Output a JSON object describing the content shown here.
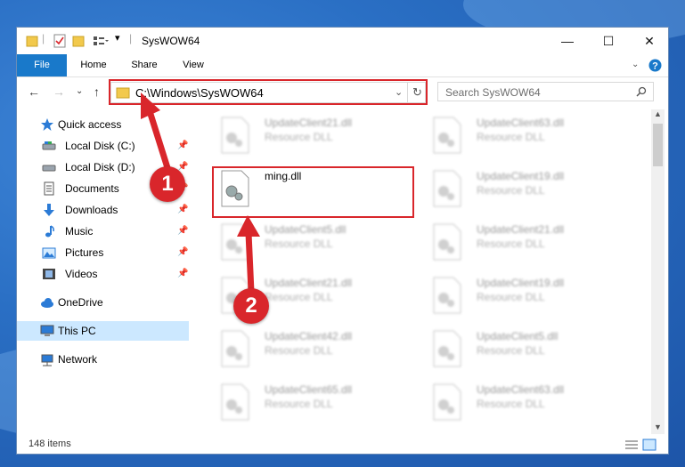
{
  "window": {
    "title": "SysWOW64"
  },
  "ribbon": {
    "tabs": [
      "File",
      "Home",
      "Share",
      "View"
    ]
  },
  "address": {
    "path": "C:\\Windows\\SysWOW64"
  },
  "search": {
    "placeholder": "Search SysWOW64"
  },
  "nav": {
    "items": [
      {
        "label": "Quick access",
        "pinned": false
      },
      {
        "label": "Local Disk (C:)",
        "pinned": true
      },
      {
        "label": "Local Disk (D:)",
        "pinned": true
      },
      {
        "label": "Documents",
        "pinned": true
      },
      {
        "label": "Downloads",
        "pinned": true
      },
      {
        "label": "Music",
        "pinned": true
      },
      {
        "label": "Pictures",
        "pinned": true
      },
      {
        "label": "Videos",
        "pinned": true
      },
      {
        "label": "OneDrive",
        "pinned": false
      },
      {
        "label": "This PC",
        "pinned": false,
        "selected": true
      },
      {
        "label": "Network",
        "pinned": false
      }
    ]
  },
  "files": {
    "left": [
      {
        "name": "UpdateClient21.dll",
        "type": "Resource DLL"
      },
      {
        "name": "ming.dll",
        "type": ""
      },
      {
        "name": "UpdateClient5.dll",
        "type": "Resource DLL"
      },
      {
        "name": "UpdateClient21.dll",
        "type": "Resource DLL"
      },
      {
        "name": "UpdateClient42.dll",
        "type": "Resource DLL"
      },
      {
        "name": "UpdateClient65.dll",
        "type": "Resource DLL"
      }
    ],
    "right": [
      {
        "name": "UpdateClient63.dll",
        "type": "Resource DLL"
      },
      {
        "name": "UpdateClient19.dll",
        "type": "Resource DLL"
      },
      {
        "name": "UpdateClient21.dll",
        "type": "Resource DLL"
      },
      {
        "name": "UpdateClient19.dll",
        "type": "Resource DLL"
      },
      {
        "name": "UpdateClient5.dll",
        "type": "Resource DLL"
      },
      {
        "name": "UpdateClient63.dll",
        "type": "Resource DLL"
      }
    ]
  },
  "status": {
    "item_count": "148 items"
  },
  "annotations": {
    "step1": "1",
    "step2": "2"
  },
  "colors": {
    "accent": "#1979ca",
    "highlight": "#d9262b",
    "selected": "#cce8ff"
  }
}
